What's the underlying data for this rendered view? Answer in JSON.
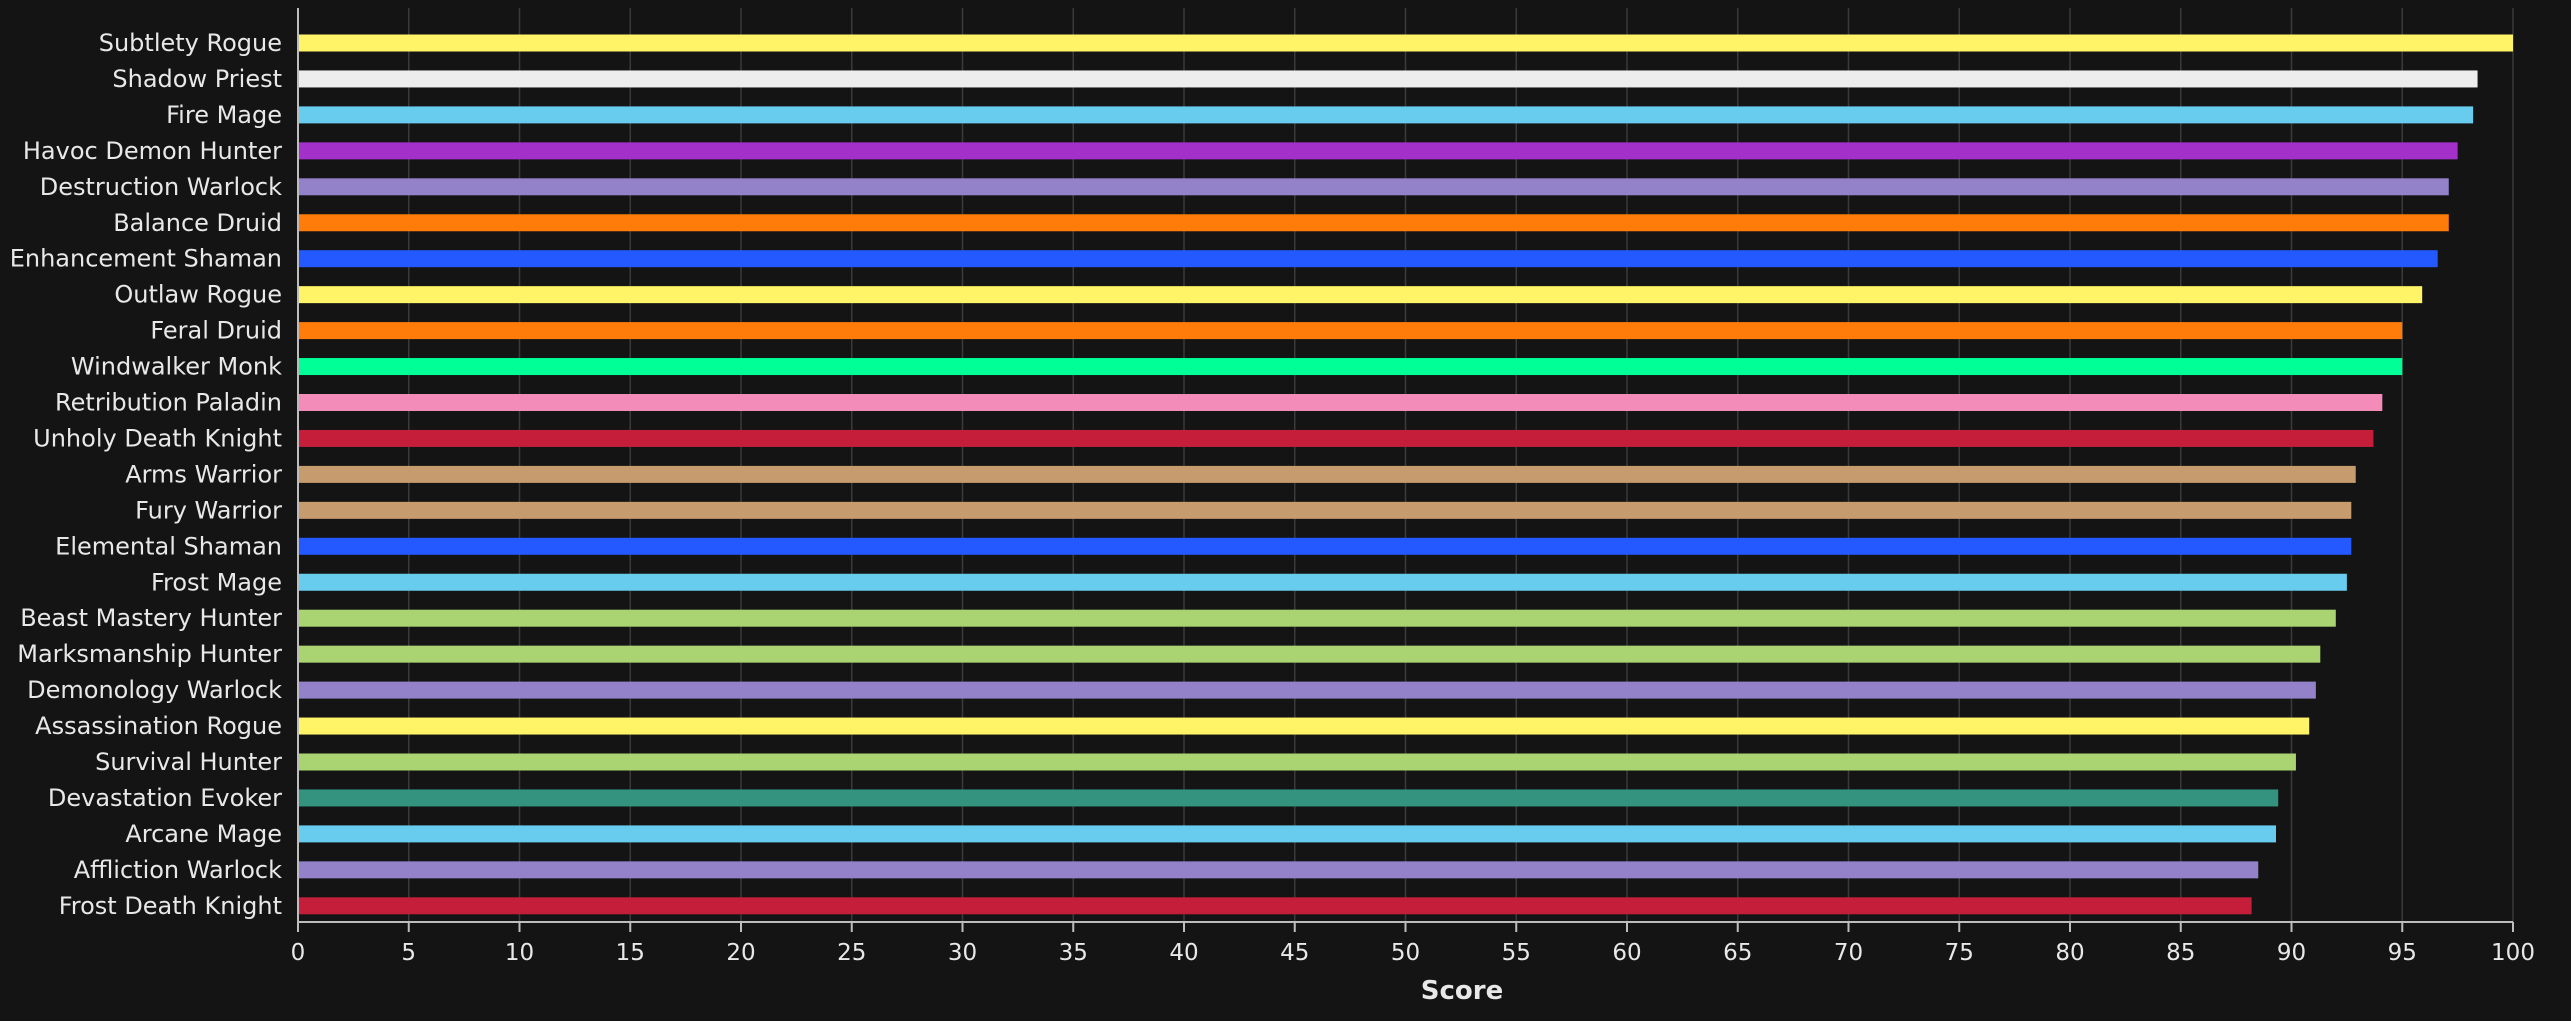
{
  "chart_data": {
    "type": "bar",
    "orientation": "horizontal",
    "xlabel": "Score",
    "xlim": [
      0,
      100
    ],
    "xticks": [
      0,
      5,
      10,
      15,
      20,
      25,
      30,
      35,
      40,
      45,
      50,
      55,
      60,
      65,
      70,
      75,
      80,
      85,
      90,
      95,
      100
    ],
    "grid": true,
    "categories": [
      "Subtlety Rogue",
      "Shadow Priest",
      "Fire Mage",
      "Havoc Demon Hunter",
      "Destruction Warlock",
      "Balance Druid",
      "Enhancement Shaman",
      "Outlaw Rogue",
      "Feral Druid",
      "Windwalker Monk",
      "Retribution Paladin",
      "Unholy Death Knight",
      "Arms Warrior",
      "Fury Warrior",
      "Elemental Shaman",
      "Frost Mage",
      "Beast Mastery Hunter",
      "Marksmanship Hunter",
      "Demonology Warlock",
      "Assassination Rogue",
      "Survival Hunter",
      "Devastation Evoker",
      "Arcane Mage",
      "Affliction Warlock",
      "Frost Death Knight"
    ],
    "values": [
      100,
      98.4,
      98.2,
      97.5,
      97.1,
      97.1,
      96.6,
      95.9,
      95.0,
      95.0,
      94.1,
      93.7,
      92.9,
      92.7,
      92.7,
      92.5,
      92.0,
      91.3,
      91.1,
      90.8,
      90.2,
      89.4,
      89.3,
      88.5,
      88.2
    ],
    "colors": [
      "#FFF468",
      "#EDEDED",
      "#68CCEF",
      "#A330C9",
      "#9382C9",
      "#FF7C0A",
      "#2359FF",
      "#FFF468",
      "#FF7C0A",
      "#00FF96",
      "#F48CBA",
      "#C41E3A",
      "#C69B6D",
      "#C69B6D",
      "#2359FF",
      "#68CCEF",
      "#AAD372",
      "#AAD372",
      "#9382C9",
      "#FFF468",
      "#AAD372",
      "#33937F",
      "#68CCEF",
      "#9382C9",
      "#C41E3A"
    ]
  }
}
